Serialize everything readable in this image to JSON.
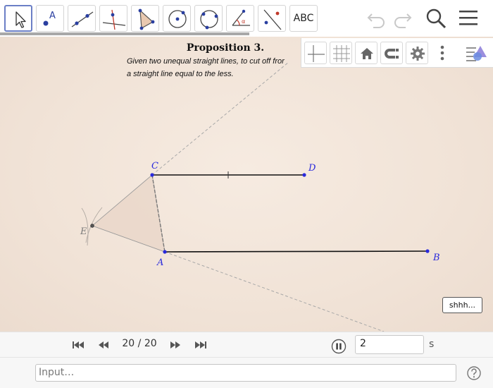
{
  "toolbar": {
    "tools": [
      {
        "name": "move-tool",
        "icon": "pointer-arrow-icon",
        "active": true
      },
      {
        "name": "point-tool",
        "icon": "point-with-label-icon",
        "label": "A"
      },
      {
        "name": "line-tool",
        "icon": "line-through-points-icon"
      },
      {
        "name": "perpendicular-tool",
        "icon": "perpendicular-line-icon"
      },
      {
        "name": "polygon-tool",
        "icon": "polygon-icon"
      },
      {
        "name": "circle-center-point-tool",
        "icon": "circle-center-point-icon"
      },
      {
        "name": "circle-three-points-tool",
        "icon": "circle-three-points-icon"
      },
      {
        "name": "angle-tool",
        "icon": "angle-icon"
      },
      {
        "name": "reflect-tool",
        "icon": "reflect-about-line-icon"
      },
      {
        "name": "text-tool",
        "icon": "text-icon",
        "label": "ABC"
      }
    ],
    "right_icons": [
      "undo-icon",
      "redo-icon",
      "search-icon",
      "menu-icon"
    ]
  },
  "construction": {
    "title": "Proposition 3.",
    "text_line1": "Given two unequal straight lines,  to cut off fror",
    "text_line2": "a straight line equal to the less.",
    "labels": {
      "A": "A",
      "B": "B",
      "C": "C",
      "D": "D",
      "E": "E"
    }
  },
  "style_bar": {
    "icons": [
      "axes-icon",
      "grid-icon",
      "home-icon",
      "magnet-snap-icon",
      "gear-icon",
      "more-vertical-icon",
      "algebra-graphics-toggle-icon"
    ]
  },
  "shhh_button": "shhh...",
  "animation": {
    "step_current": "20",
    "step_total": "20",
    "step_separator": " / ",
    "speed_value": "2",
    "speed_unit": "s"
  },
  "input_bar": {
    "placeholder": "Input…",
    "help_icon": "question-circle-icon"
  },
  "colors": {
    "accent": "#6b7fc6",
    "point_blue": "#2a2adc",
    "canvas_bg": "#f3e6da"
  }
}
